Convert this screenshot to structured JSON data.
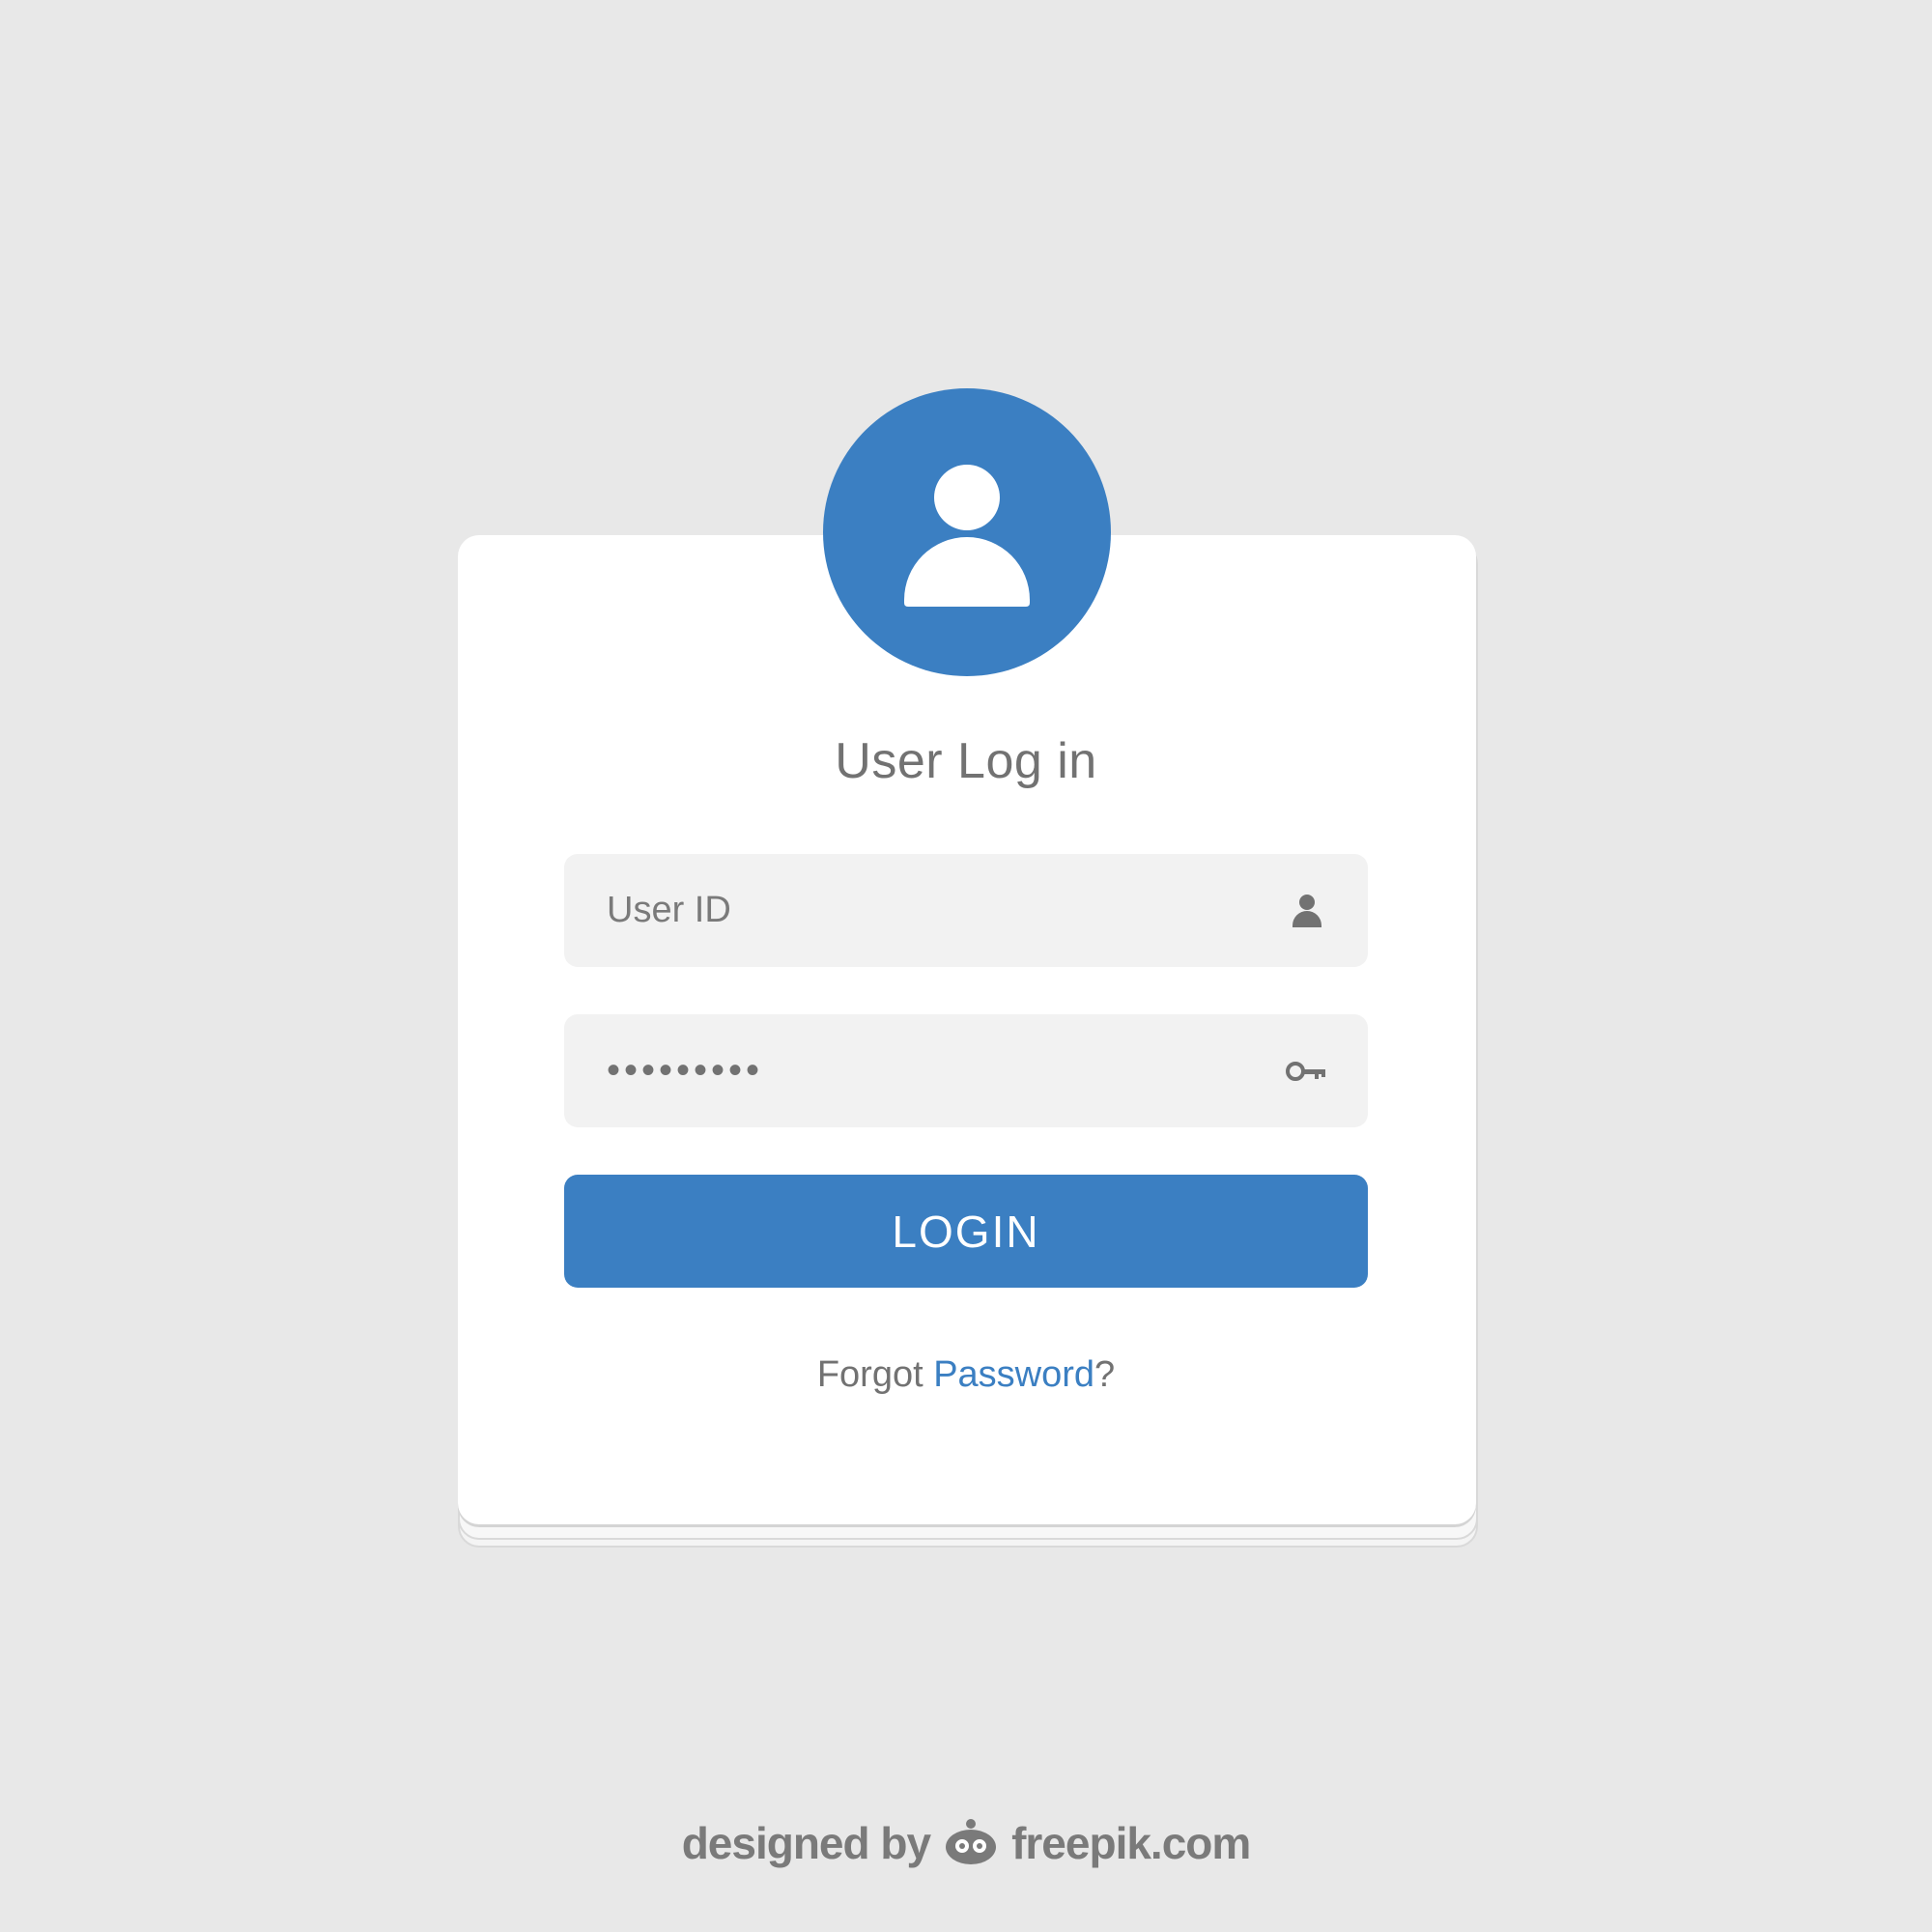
{
  "login": {
    "title": "User Log in",
    "user_field": {
      "placeholder": "User ID",
      "value": "",
      "icon": "user-icon"
    },
    "password_field": {
      "value": "•••••••••",
      "icon": "key-icon"
    },
    "login_button_label": "LOGIN",
    "forgot": {
      "prefix": "Forgot ",
      "link": "Password",
      "suffix": "?"
    },
    "avatar_icon": "user-avatar-icon"
  },
  "credit": {
    "prefix": "designed by",
    "site": "freepik.com"
  },
  "colors": {
    "background": "#e8e8e8",
    "accent": "#3b7fc2",
    "card": "#ffffff",
    "field": "#f2f2f2",
    "text": "#727272"
  }
}
